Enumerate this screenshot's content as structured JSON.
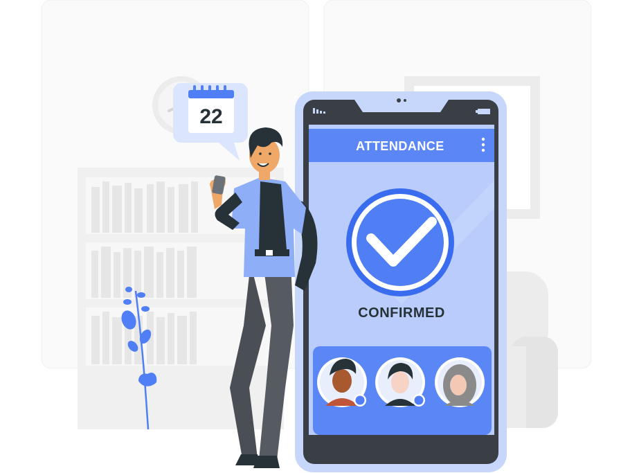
{
  "calendar": {
    "day": "22"
  },
  "app": {
    "title": "ATTENDANCE",
    "status": "CONFIRMED"
  },
  "colors": {
    "accent": "#4f7ef5",
    "accent_dark": "#2f5fe0",
    "accent_light": "#b9ccfb",
    "phone_frame": "#3a3f45",
    "bg_gray": "#f2f2f2"
  },
  "icons": {
    "check": "check-circle-icon",
    "menu": "kebab-menu-icon",
    "calendar": "calendar-icon",
    "clock": "clock-icon"
  }
}
